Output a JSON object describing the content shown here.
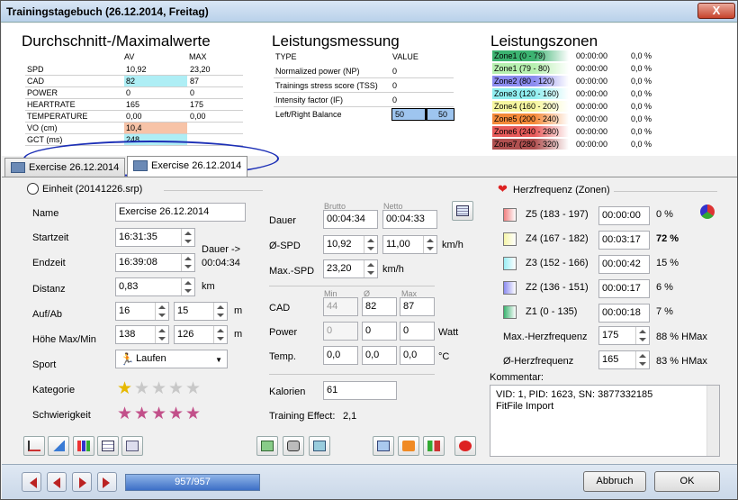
{
  "window": {
    "title": "Trainingstagebuch (26.12.2014, Freitag)",
    "close": "X"
  },
  "avg": {
    "title": "Durchschnitt-/Maximalwerte",
    "col_av": "AV",
    "col_max": "MAX",
    "rows": [
      {
        "label": "SPD",
        "av": "10,92",
        "max": "23,20",
        "color": ""
      },
      {
        "label": "CAD",
        "av": "82",
        "max": "87",
        "color": "#aeeef5"
      },
      {
        "label": "POWER",
        "av": "0",
        "max": "0",
        "color": ""
      },
      {
        "label": "HEARTRATE",
        "av": "165",
        "max": "175",
        "color": ""
      },
      {
        "label": "TEMPERATURE",
        "av": "0,00",
        "max": "0,00",
        "color": ""
      },
      {
        "label": "VO (cm)",
        "av": "10,4",
        "max": "",
        "color": "#f7c3a7"
      },
      {
        "label": "GCT (ms)",
        "av": "248",
        "max": "",
        "color": "#aeeef5"
      }
    ]
  },
  "perf": {
    "title": "Leistungsmessung",
    "col_type": "TYPE",
    "col_value": "VALUE",
    "rows": [
      {
        "label": "Normalized power (NP)",
        "value": "0"
      },
      {
        "label": "Trainings stress score (TSS)",
        "value": "0"
      },
      {
        "label": "Intensity factor (IF)",
        "value": "0"
      }
    ],
    "balance_label": "Left/Right Balance",
    "balance_left": "50",
    "balance_right": "50"
  },
  "zones": {
    "title": "Leistungszonen",
    "rows": [
      {
        "label": "Zone1 (0 - 79)",
        "time": "00:00:00",
        "pct": "0,0 %",
        "color": "#3cb371"
      },
      {
        "label": "Zone1 (79 - 80)",
        "time": "00:00:00",
        "pct": "0,0 %",
        "color": "#b7f0b0"
      },
      {
        "label": "Zone2 (80 - 120)",
        "time": "00:00:00",
        "pct": "0,0 %",
        "color": "#8c8cf0"
      },
      {
        "label": "Zone3 (120 - 160)",
        "time": "00:00:00",
        "pct": "0,0 %",
        "color": "#90eef0"
      },
      {
        "label": "Zone4 (160 - 200)",
        "time": "00:00:00",
        "pct": "0,0 %",
        "color": "#f6f6a0"
      },
      {
        "label": "Zone5 (200 - 240)",
        "time": "00:00:00",
        "pct": "0,0 %",
        "color": "#f58a3a"
      },
      {
        "label": "Zone6 (240 - 280)",
        "time": "00:00:00",
        "pct": "0,0 %",
        "color": "#e85a5a"
      },
      {
        "label": "Zone7 (280 - 320)",
        "time": "00:00:00",
        "pct": "0,0 %",
        "color": "#b05050"
      }
    ]
  },
  "tabs": [
    {
      "label": "Exercise 26.12.2014"
    },
    {
      "label": "Exercise 26.12.2014"
    }
  ],
  "unit": {
    "header": "Einheit (20141226.srp)",
    "name_label": "Name",
    "name": "Exercise 26.12.2014",
    "start_label": "Startzeit",
    "start": "16:31:35",
    "end_label": "Endzeit",
    "end": "16:39:08",
    "duration_note": "Dauer ->",
    "duration_value": "00:04:34",
    "distance_label": "Distanz",
    "distance": "0,83",
    "distance_unit": "km",
    "updown_label": "Auf/Ab",
    "up": "16",
    "down": "15",
    "updown_unit": "m",
    "height_label": "Höhe Max/Min",
    "hmax": "138",
    "hmin": "126",
    "height_unit": "m",
    "sport_label": "Sport",
    "sport": "Laufen",
    "category_label": "Kategorie",
    "difficulty_label": "Schwierigkeit"
  },
  "mid": {
    "brutto": "Brutto",
    "netto": "Netto",
    "dauer_label": "Dauer",
    "dauer_brutto": "00:04:34",
    "dauer_netto": "00:04:33",
    "spd_label": "Ø-SPD",
    "spd_brutto": "10,92",
    "spd_netto": "11,00",
    "spd_unit": "km/h",
    "maxspd_label": "Max.-SPD",
    "maxspd": "23,20",
    "maxspd_unit": "km/h",
    "min": "Min",
    "avg": "Ø",
    "max": "Max",
    "cad_label": "CAD",
    "cad_min": "44",
    "cad_avg": "82",
    "cad_max": "87",
    "power_label": "Power",
    "power_min": "0",
    "power_avg": "0",
    "power_max": "0",
    "power_unit": "Watt",
    "temp_label": "Temp.",
    "temp_min": "0,0",
    "temp_avg": "0,0",
    "temp_max": "0,0",
    "temp_unit": "°C",
    "cal_label": "Kalorien",
    "cal": "61",
    "te_label": "Training Effect:",
    "te": "2,1"
  },
  "hr": {
    "header": "Herzfrequenz (Zonen)",
    "zones": [
      {
        "label": "Z5 (183 - 197)",
        "time": "00:00:00",
        "pct": "0 %",
        "color": "#f08080",
        "bold": false
      },
      {
        "label": "Z4 (167 - 182)",
        "time": "00:03:17",
        "pct": "72 %",
        "color": "#f5f5a8",
        "bold": true
      },
      {
        "label": "Z3 (152 - 166)",
        "time": "00:00:42",
        "pct": "15 %",
        "color": "#9aeef5",
        "bold": false
      },
      {
        "label": "Z2 (136 - 151)",
        "time": "00:00:17",
        "pct": "6 %",
        "color": "#8c8cf0",
        "bold": false
      },
      {
        "label": "Z1 (0 - 135)",
        "time": "00:00:18",
        "pct": "7 %",
        "color": "#3cb371",
        "bold": false
      }
    ],
    "max_label": "Max.-Herzfrequenz",
    "max": "175",
    "max_pct": "88 % HMax",
    "avg_label": "Ø-Herzfrequenz",
    "avg": "165",
    "avg_pct": "83 % HMax",
    "comment_label": "Kommentar:",
    "comment_line1": "VID: 1, PID: 1623, SN: 3877332185",
    "comment_line2": "FitFile Import"
  },
  "footer": {
    "progress": "957/957",
    "cancel": "Abbruch",
    "ok": "OK"
  },
  "ratings": {
    "category": 1,
    "difficulty": 5
  }
}
